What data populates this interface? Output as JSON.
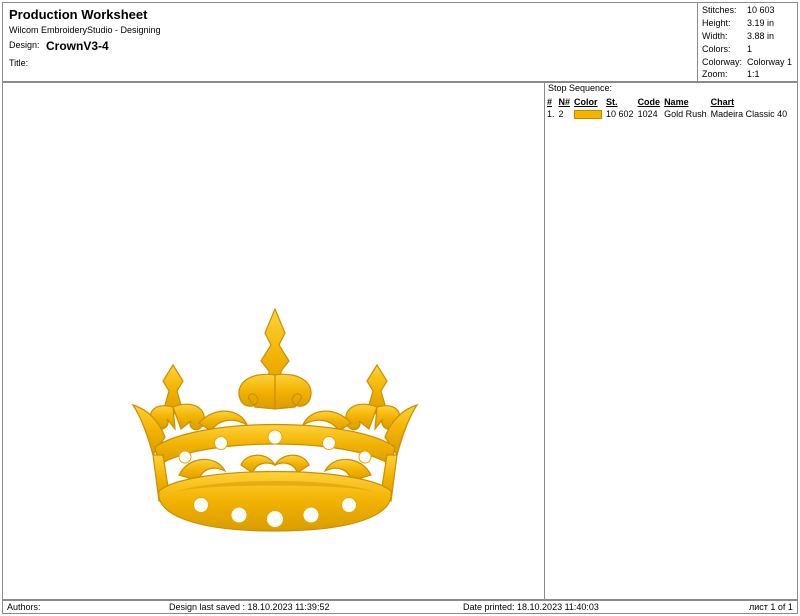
{
  "header": {
    "document_title": "Production Worksheet",
    "app_name": "Wilcom EmbroideryStudio - Designing",
    "design_label": "Design:",
    "design_name": "CrownV3-4",
    "title_label": "Title:"
  },
  "stats": [
    {
      "label": "Stitches:",
      "value": "10 603"
    },
    {
      "label": "Height:",
      "value": "3.19 in"
    },
    {
      "label": "Width:",
      "value": "3.88 in"
    },
    {
      "label": "Colors:",
      "value": "1"
    },
    {
      "label": "Colorway:",
      "value": "Colorway 1"
    },
    {
      "label": "Zoom:",
      "value": "1:1"
    }
  ],
  "stop_sequence": {
    "title": "Stop Sequence:",
    "columns": {
      "idx": "#",
      "n": "N#",
      "color": "Color",
      "st": "St.",
      "code": "Code",
      "name": "Name",
      "chart": "Chart"
    },
    "rows": [
      {
        "idx": "1.",
        "n": "2",
        "color": "#f5b400",
        "st": "10 602",
        "code": "1024",
        "name": "Gold Rush",
        "chart": "Madeira Classic 40"
      }
    ]
  },
  "design_preview": {
    "thread_color": "#f2b200",
    "shadow_color": "#c98f00",
    "icon": "crown-embroidery"
  },
  "footer": {
    "authors": "Authors:",
    "last_saved": "Design last saved : 18.10.2023 11:39:52",
    "printed": "Date printed: 18.10.2023 11:40:03",
    "page": "лист 1 of 1"
  }
}
